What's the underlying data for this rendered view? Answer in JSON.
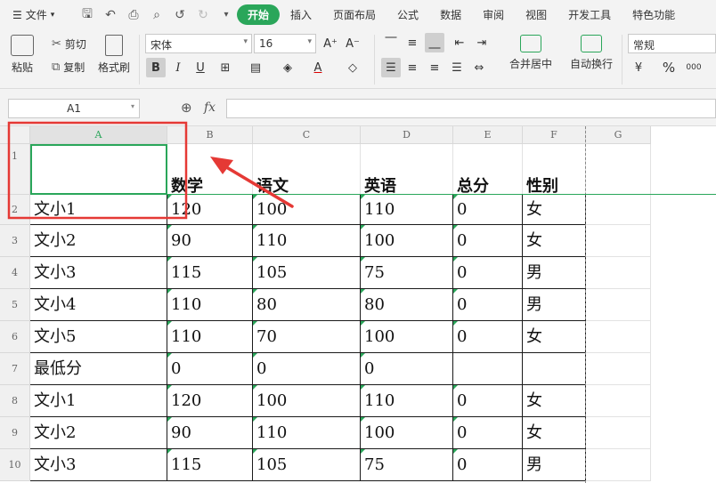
{
  "menubar": {
    "file_label": "文件",
    "quick_access_icons": [
      "save-icon",
      "undo-history-icon",
      "print-icon",
      "print-preview-icon",
      "undo-icon",
      "redo-icon",
      "customize-icon"
    ],
    "tabs": [
      {
        "label": "开始",
        "active": true
      },
      {
        "label": "插入"
      },
      {
        "label": "页面布局"
      },
      {
        "label": "公式"
      },
      {
        "label": "数据"
      },
      {
        "label": "审阅"
      },
      {
        "label": "视图"
      },
      {
        "label": "开发工具"
      },
      {
        "label": "特色功能"
      }
    ]
  },
  "ribbon": {
    "paste_label": "粘贴",
    "cut_label": "剪切",
    "copy_label": "复制",
    "format_painter_label": "格式刷",
    "font_name": "宋体",
    "font_size": "16",
    "bold_label": "B",
    "italic_label": "I",
    "underline_label": "U",
    "merge_center_label": "合并居中",
    "wrap_text_label": "自动换行",
    "number_format": "常规",
    "percent_label": "%",
    "thousands_label": "000"
  },
  "formula_bar": {
    "name_box": "A1",
    "fx_label": "fx",
    "formula": ""
  },
  "sheet": {
    "columns": [
      "A",
      "B",
      "C",
      "D",
      "E",
      "F",
      "G"
    ],
    "selected_cell": "A1",
    "rows": [
      {
        "n": "1",
        "cells": [
          "",
          "数学",
          "语文",
          "英语",
          "总分",
          "性别"
        ]
      },
      {
        "n": "2",
        "cells": [
          "文小1",
          "120",
          "100",
          "110",
          "0",
          "女"
        ]
      },
      {
        "n": "3",
        "cells": [
          "文小2",
          "90",
          "110",
          "100",
          "0",
          "女"
        ]
      },
      {
        "n": "4",
        "cells": [
          "文小3",
          "115",
          "105",
          "75",
          "0",
          "男"
        ]
      },
      {
        "n": "5",
        "cells": [
          "文小4",
          "110",
          "80",
          "80",
          "0",
          "男"
        ]
      },
      {
        "n": "6",
        "cells": [
          "文小5",
          "110",
          "70",
          "100",
          "0",
          "女"
        ]
      },
      {
        "n": "7",
        "cells": [
          "最低分",
          "0",
          "0",
          "0",
          "",
          ""
        ]
      },
      {
        "n": "8",
        "cells": [
          "文小1",
          "120",
          "100",
          "110",
          "0",
          "女"
        ]
      },
      {
        "n": "9",
        "cells": [
          "文小2",
          "90",
          "110",
          "100",
          "0",
          "女"
        ]
      },
      {
        "n": "10",
        "cells": [
          "文小3",
          "115",
          "105",
          "75",
          "0",
          "男"
        ]
      }
    ]
  },
  "annotation": {
    "highlight_color": "#e53935",
    "accent_color": "#2aa65a"
  }
}
